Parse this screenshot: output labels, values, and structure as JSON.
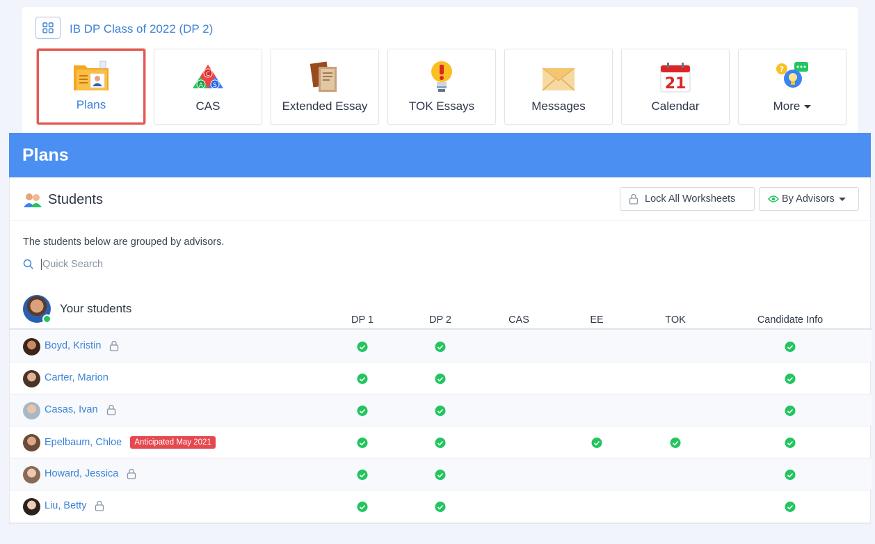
{
  "header": {
    "class_title": "IB DP Class of 2022 (DP 2)",
    "tiles": [
      {
        "label": "Plans",
        "icon": "plans-folder-icon",
        "active": true
      },
      {
        "label": "CAS",
        "icon": "cas-triangle-icon"
      },
      {
        "label": "Extended Essay",
        "icon": "extended-essay-books-icon"
      },
      {
        "label": "TOK Essays",
        "icon": "lightbulb-icon"
      },
      {
        "label": "Messages",
        "icon": "envelope-icon"
      },
      {
        "label": "Calendar",
        "icon": "calendar-icon",
        "day": "21"
      },
      {
        "label": "More",
        "icon": "help-chat-icon",
        "dropdown": true
      }
    ]
  },
  "banner": {
    "title": "Plans"
  },
  "students": {
    "title": "Students",
    "lock_all_label": "Lock All Worksheets",
    "group_by_label": "By Advisors",
    "intro": "The students below are grouped by advisors.",
    "search_placeholder": "Quick Search",
    "group_title": "Your students",
    "columns": [
      "DP 1",
      "DP 2",
      "CAS",
      "EE",
      "TOK",
      "Candidate Info"
    ],
    "rows": [
      {
        "name": "Boyd, Kristin",
        "locked": true,
        "badge": "",
        "checks": [
          true,
          true,
          false,
          false,
          false,
          true
        ]
      },
      {
        "name": "Carter, Marion",
        "locked": false,
        "badge": "",
        "checks": [
          true,
          true,
          false,
          false,
          false,
          true
        ]
      },
      {
        "name": "Casas, Ivan",
        "locked": true,
        "badge": "",
        "checks": [
          true,
          true,
          false,
          false,
          false,
          true
        ]
      },
      {
        "name": "Epelbaum, Chloe",
        "locked": false,
        "badge": "Anticipated May 2021",
        "checks": [
          true,
          true,
          false,
          true,
          true,
          true
        ]
      },
      {
        "name": "Howard, Jessica",
        "locked": true,
        "badge": "",
        "checks": [
          true,
          true,
          false,
          false,
          false,
          true
        ]
      },
      {
        "name": "Liu, Betty",
        "locked": true,
        "badge": "",
        "checks": [
          true,
          true,
          false,
          false,
          false,
          true
        ]
      }
    ]
  },
  "colors": {
    "accent": "#3b82d6",
    "banner": "#4b8ff2",
    "success": "#22c55e",
    "badge": "#e5484d"
  }
}
